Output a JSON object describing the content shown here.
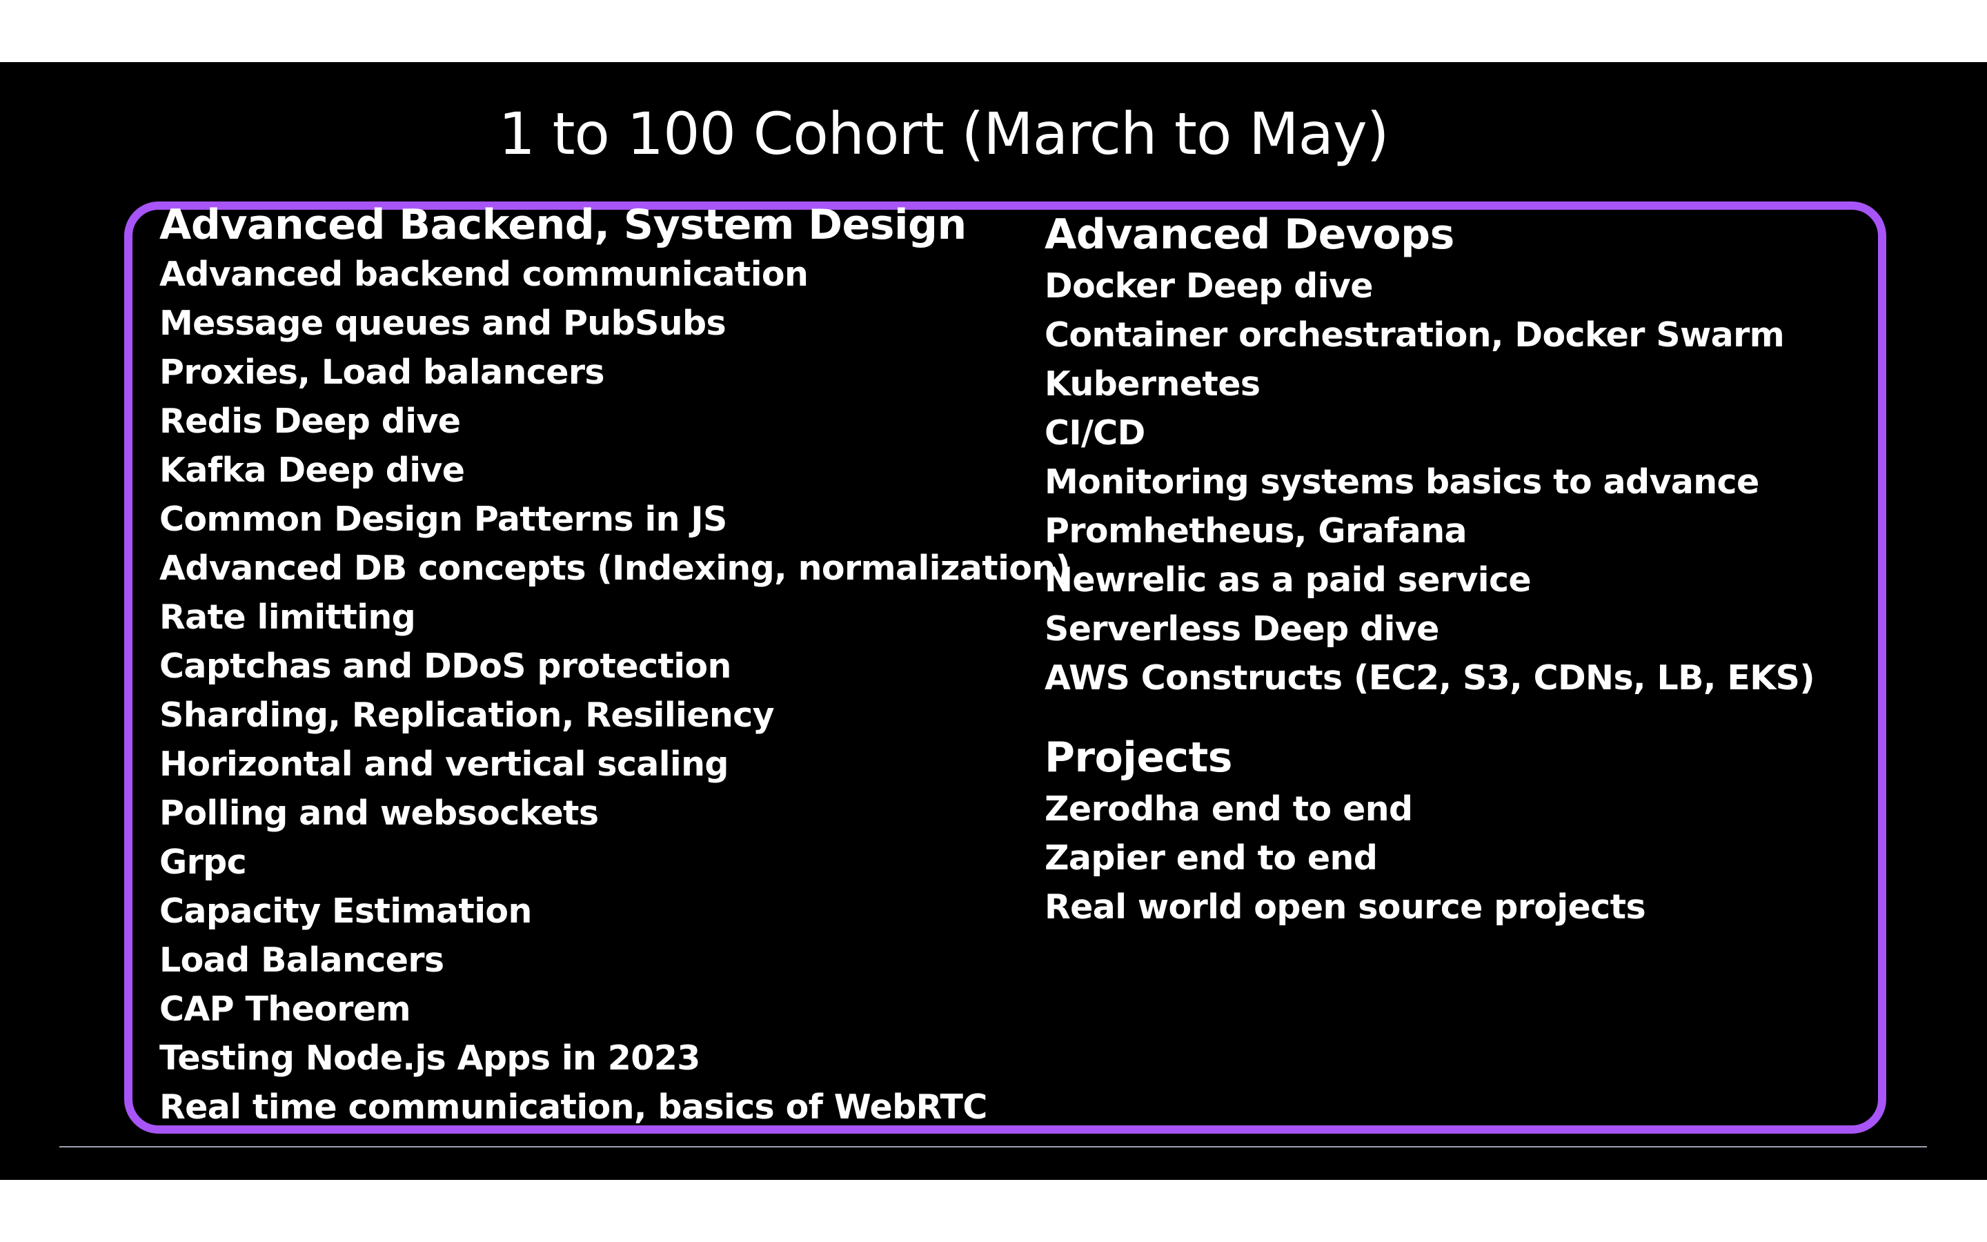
{
  "slide": {
    "title": "1 to 100 Cohort (March to May)",
    "accent_color": "#a855f7",
    "background_color": "#000000"
  },
  "left_column": {
    "heading": "Advanced Backend, System Design",
    "items": [
      "Advanced backend communication",
      "Message queues and PubSubs",
      "Proxies, Load balancers",
      "Redis Deep dive",
      "Kafka Deep dive",
      "Common Design Patterns in JS",
      "Advanced DB concepts (Indexing, normalization)",
      "Rate limitting",
      "Captchas and DDoS protection",
      "Sharding, Replication, Resiliency",
      "Horizontal and vertical scaling",
      "Polling and websockets",
      "Grpc",
      "Capacity Estimation",
      "Load Balancers",
      "CAP Theorem",
      "Testing Node.js Apps in 2023",
      "Real time communication, basics of WebRTC"
    ]
  },
  "right_column": {
    "devops_heading": "Advanced Devops",
    "devops_items": [
      "Docker Deep dive",
      "Container orchestration, Docker Swarm",
      "Kubernetes",
      "CI/CD",
      "Monitoring systems basics to advance",
      "Promhetheus, Grafana",
      "Newrelic as a paid service",
      "Serverless Deep dive",
      "AWS Constructs (EC2, S3, CDNs, LB, EKS)"
    ],
    "projects_heading": "Projects",
    "projects_items": [
      "Zerodha end to end",
      "Zapier end to end",
      "Real world open source projects"
    ]
  }
}
